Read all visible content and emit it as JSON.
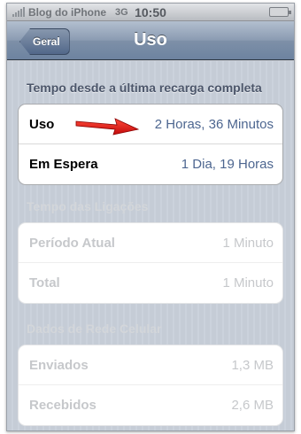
{
  "status_bar": {
    "carrier": "Blog do iPhone",
    "network": "3G",
    "time": "10:50"
  },
  "nav": {
    "back_label": "Geral",
    "title": "Uso"
  },
  "recharge_section": {
    "header": "Tempo desde a última recarga completa",
    "rows": [
      {
        "label": "Uso",
        "value": "2 Horas, 36 Minutos"
      },
      {
        "label": "Em Espera",
        "value": "1 Dia, 19 Horas"
      }
    ]
  },
  "calls_section": {
    "header": "Tempo das Ligações",
    "rows": [
      {
        "label": "Período Atual",
        "value": "1 Minuto"
      },
      {
        "label": "Total",
        "value": "1 Minuto"
      }
    ]
  },
  "cellular_section": {
    "header": "Dados de Rede Celular",
    "rows": [
      {
        "label": "Enviados",
        "value": "1,3 MB"
      },
      {
        "label": "Recebidos",
        "value": "2,6 MB"
      }
    ]
  },
  "colors": {
    "nav_bar": "#6d83a0",
    "value_text": "#4d6690",
    "arrow": "#e01010"
  },
  "icons": [
    "signal-icon",
    "battery-icon",
    "red-arrow-icon"
  ]
}
